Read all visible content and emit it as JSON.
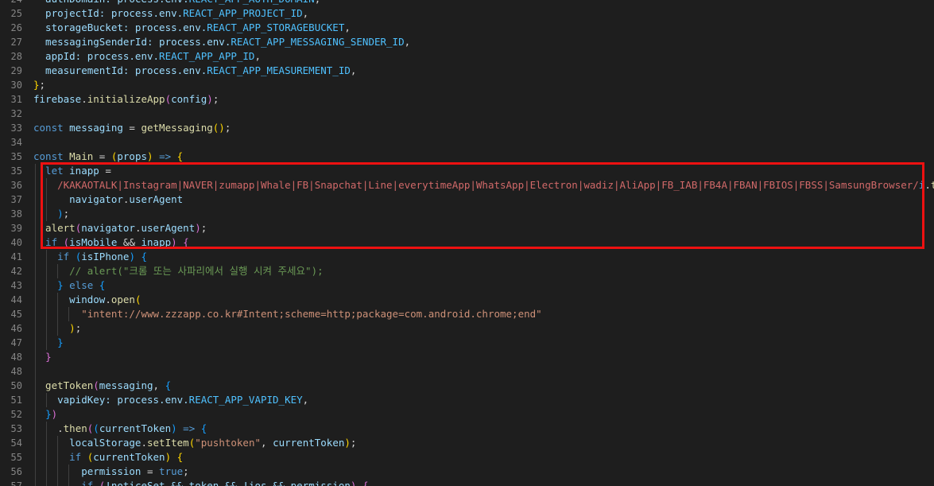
{
  "editor": {
    "lines": [
      {
        "n": "24",
        "tokens": [
          {
            "t": "  authDomain: process.env.",
            "c": "var"
          },
          {
            "t": "REACT_APP_AUTH_DOMAIN",
            "c": "const"
          },
          {
            "t": ",",
            "c": "punc"
          }
        ]
      },
      {
        "n": "25",
        "tokens": [
          {
            "t": "  projectId: process.env.",
            "c": "var"
          },
          {
            "t": "REACT_APP_PROJECT_ID",
            "c": "const"
          },
          {
            "t": ",",
            "c": "punc"
          }
        ]
      },
      {
        "n": "26",
        "tokens": [
          {
            "t": "  storageBucket: process.env.",
            "c": "var"
          },
          {
            "t": "REACT_APP_STORAGEBUCKET",
            "c": "const"
          },
          {
            "t": ",",
            "c": "punc"
          }
        ]
      },
      {
        "n": "27",
        "tokens": [
          {
            "t": "  messagingSenderId: process.env.",
            "c": "var"
          },
          {
            "t": "REACT_APP_MESSAGING_SENDER_ID",
            "c": "const"
          },
          {
            "t": ",",
            "c": "punc"
          }
        ]
      },
      {
        "n": "28",
        "tokens": [
          {
            "t": "  appId: process.env.",
            "c": "var"
          },
          {
            "t": "REACT_APP_APP_ID",
            "c": "const"
          },
          {
            "t": ",",
            "c": "punc"
          }
        ]
      },
      {
        "n": "29",
        "tokens": [
          {
            "t": "  measurementId: process.env.",
            "c": "var"
          },
          {
            "t": "REACT_APP_MEASUREMENT_ID",
            "c": "const"
          },
          {
            "t": ",",
            "c": "punc"
          }
        ]
      },
      {
        "n": "30",
        "tokens": [
          {
            "t": "}",
            "c": "brace"
          },
          {
            "t": ";",
            "c": "punc"
          }
        ]
      },
      {
        "n": "31",
        "tokens": [
          {
            "t": "firebase",
            "c": "var"
          },
          {
            "t": ".",
            "c": "punc"
          },
          {
            "t": "initializeApp",
            "c": "fn"
          },
          {
            "t": "(",
            "c": "brace2"
          },
          {
            "t": "config",
            "c": "var"
          },
          {
            "t": ")",
            "c": "brace2"
          },
          {
            "t": ";",
            "c": "punc"
          }
        ]
      },
      {
        "n": "32",
        "tokens": []
      },
      {
        "n": "33",
        "tokens": [
          {
            "t": "const ",
            "c": "kw"
          },
          {
            "t": "messaging",
            "c": "var"
          },
          {
            "t": " = ",
            "c": "op"
          },
          {
            "t": "getMessaging",
            "c": "fn"
          },
          {
            "t": "()",
            "c": "brace"
          },
          {
            "t": ";",
            "c": "punc"
          }
        ]
      },
      {
        "n": "34",
        "tokens": []
      },
      {
        "n": "35",
        "tokens": [
          {
            "t": "const ",
            "c": "kw"
          },
          {
            "t": "Main",
            "c": "fn"
          },
          {
            "t": " = ",
            "c": "op"
          },
          {
            "t": "(",
            "c": "brace"
          },
          {
            "t": "props",
            "c": "var"
          },
          {
            "t": ")",
            "c": "brace"
          },
          {
            "t": " => ",
            "c": "kw"
          },
          {
            "t": "{",
            "c": "brace"
          }
        ]
      },
      {
        "n": "35",
        "tokens": [
          {
            "t": "  let ",
            "c": "kw"
          },
          {
            "t": "inapp",
            "c": "var"
          },
          {
            "t": " =",
            "c": "op"
          }
        ]
      },
      {
        "n": "36",
        "tokens": [
          {
            "t": "    /KAKAOTALK|Instagram|NAVER|zumapp|Whale|FB|Snapchat|Line|everytimeApp|WhatsApp|Electron|wadiz|AliApp|FB_IAB|FB4A|FBAN|FBIOS|FBSS|SamsungBrowser/",
            "c": "re"
          },
          {
            "t": "i",
            "c": "kw"
          },
          {
            "t": ".",
            "c": "punc"
          },
          {
            "t": "test",
            "c": "fn"
          },
          {
            "t": "(",
            "c": "brace3"
          }
        ]
      },
      {
        "n": "37",
        "tokens": [
          {
            "t": "      navigator",
            "c": "var"
          },
          {
            "t": ".",
            "c": "punc"
          },
          {
            "t": "userAgent",
            "c": "var"
          }
        ]
      },
      {
        "n": "38",
        "tokens": [
          {
            "t": "    ",
            "c": "punc"
          },
          {
            "t": ")",
            "c": "brace3"
          },
          {
            "t": ";",
            "c": "punc"
          }
        ]
      },
      {
        "n": "39",
        "tokens": [
          {
            "t": "  alert",
            "c": "fn"
          },
          {
            "t": "(",
            "c": "brace2"
          },
          {
            "t": "navigator",
            "c": "var"
          },
          {
            "t": ".",
            "c": "punc"
          },
          {
            "t": "userAgent",
            "c": "var"
          },
          {
            "t": ")",
            "c": "brace2"
          },
          {
            "t": ";",
            "c": "punc"
          }
        ]
      },
      {
        "n": "40",
        "tokens": [
          {
            "t": "  if ",
            "c": "kw"
          },
          {
            "t": "(",
            "c": "brace2"
          },
          {
            "t": "isMobile",
            "c": "var"
          },
          {
            "t": " && ",
            "c": "op"
          },
          {
            "t": "inapp",
            "c": "var"
          },
          {
            "t": ")",
            "c": "brace2"
          },
          {
            "t": " ",
            "c": "punc"
          },
          {
            "t": "{",
            "c": "brace2"
          }
        ]
      },
      {
        "n": "41",
        "tokens": [
          {
            "t": "    if ",
            "c": "kw"
          },
          {
            "t": "(",
            "c": "brace3"
          },
          {
            "t": "isIPhone",
            "c": "var"
          },
          {
            "t": ")",
            "c": "brace3"
          },
          {
            "t": " ",
            "c": "punc"
          },
          {
            "t": "{",
            "c": "brace3"
          }
        ]
      },
      {
        "n": "42",
        "tokens": [
          {
            "t": "      // alert(\"크롬 또는 사파리에서 실행 시켜 주세요\");",
            "c": "cm"
          }
        ]
      },
      {
        "n": "43",
        "tokens": [
          {
            "t": "    ",
            "c": "punc"
          },
          {
            "t": "}",
            "c": "brace3"
          },
          {
            "t": " else ",
            "c": "kw"
          },
          {
            "t": "{",
            "c": "brace3"
          }
        ]
      },
      {
        "n": "44",
        "tokens": [
          {
            "t": "      window",
            "c": "var"
          },
          {
            "t": ".",
            "c": "punc"
          },
          {
            "t": "open",
            "c": "fn"
          },
          {
            "t": "(",
            "c": "brace"
          }
        ]
      },
      {
        "n": "45",
        "tokens": [
          {
            "t": "        \"intent://www.zzzapp.co.kr#Intent;scheme=http;package=com.android.chrome;end\"",
            "c": "str"
          }
        ]
      },
      {
        "n": "46",
        "tokens": [
          {
            "t": "      ",
            "c": "punc"
          },
          {
            "t": ")",
            "c": "brace"
          },
          {
            "t": ";",
            "c": "punc"
          }
        ]
      },
      {
        "n": "47",
        "tokens": [
          {
            "t": "    ",
            "c": "punc"
          },
          {
            "t": "}",
            "c": "brace3"
          }
        ]
      },
      {
        "n": "48",
        "tokens": [
          {
            "t": "  ",
            "c": "punc"
          },
          {
            "t": "}",
            "c": "brace2"
          }
        ]
      },
      {
        "n": "48",
        "tokens": []
      },
      {
        "n": "50",
        "tokens": [
          {
            "t": "  getToken",
            "c": "fn"
          },
          {
            "t": "(",
            "c": "brace2"
          },
          {
            "t": "messaging",
            "c": "var"
          },
          {
            "t": ", ",
            "c": "punc"
          },
          {
            "t": "{",
            "c": "brace3"
          }
        ]
      },
      {
        "n": "51",
        "tokens": [
          {
            "t": "    vapidKey: process.env.",
            "c": "var"
          },
          {
            "t": "REACT_APP_VAPID_KEY",
            "c": "const"
          },
          {
            "t": ",",
            "c": "punc"
          }
        ]
      },
      {
        "n": "52",
        "tokens": [
          {
            "t": "  ",
            "c": "punc"
          },
          {
            "t": "}",
            "c": "brace3"
          },
          {
            "t": ")",
            "c": "brace2"
          }
        ]
      },
      {
        "n": "53",
        "tokens": [
          {
            "t": "    .",
            "c": "punc"
          },
          {
            "t": "then",
            "c": "fn"
          },
          {
            "t": "(",
            "c": "brace2"
          },
          {
            "t": "(",
            "c": "brace3"
          },
          {
            "t": "currentToken",
            "c": "var"
          },
          {
            "t": ")",
            "c": "brace3"
          },
          {
            "t": " => ",
            "c": "kw"
          },
          {
            "t": "{",
            "c": "brace3"
          }
        ]
      },
      {
        "n": "54",
        "tokens": [
          {
            "t": "      localStorage",
            "c": "var"
          },
          {
            "t": ".",
            "c": "punc"
          },
          {
            "t": "setItem",
            "c": "fn"
          },
          {
            "t": "(",
            "c": "brace"
          },
          {
            "t": "\"pushtoken\"",
            "c": "str"
          },
          {
            "t": ", ",
            "c": "punc"
          },
          {
            "t": "currentToken",
            "c": "var"
          },
          {
            "t": ")",
            "c": "brace"
          },
          {
            "t": ";",
            "c": "punc"
          }
        ]
      },
      {
        "n": "55",
        "tokens": [
          {
            "t": "      if ",
            "c": "kw"
          },
          {
            "t": "(",
            "c": "brace"
          },
          {
            "t": "currentToken",
            "c": "var"
          },
          {
            "t": ")",
            "c": "brace"
          },
          {
            "t": " ",
            "c": "punc"
          },
          {
            "t": "{",
            "c": "brace"
          }
        ]
      },
      {
        "n": "56",
        "tokens": [
          {
            "t": "        permission",
            "c": "var"
          },
          {
            "t": " = ",
            "c": "op"
          },
          {
            "t": "true",
            "c": "kw"
          },
          {
            "t": ";",
            "c": "punc"
          }
        ]
      },
      {
        "n": "57",
        "tokens": [
          {
            "t": "        if ",
            "c": "kw"
          },
          {
            "t": "(",
            "c": "brace2"
          },
          {
            "t": "!noticeSet && token && !ios && permission",
            "c": "var"
          },
          {
            "t": ")",
            "c": "brace2"
          },
          {
            "t": " ",
            "c": "punc"
          },
          {
            "t": "{",
            "c": "brace2"
          }
        ]
      }
    ],
    "active_line": "39"
  }
}
